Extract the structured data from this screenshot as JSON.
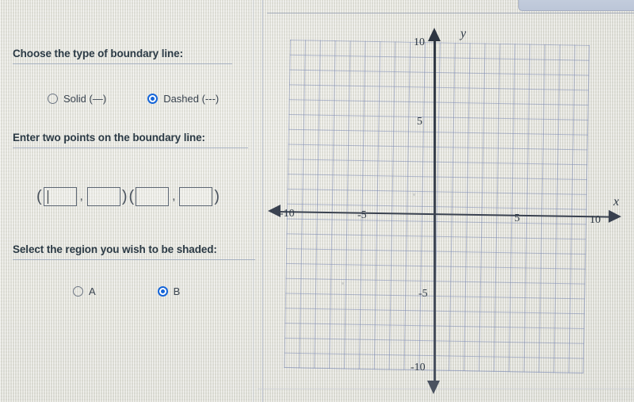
{
  "background": {
    "page_color": "#e9e9e3",
    "grid_color": "#7886b2",
    "axis_color": "#3a4250",
    "accent_color": "#1565d8"
  },
  "left_panel": {
    "question_1": {
      "heading": "Choose the type of boundary line:",
      "options": [
        {
          "label": "Solid (—)",
          "selected": false
        },
        {
          "label": "Dashed (---)",
          "selected": true
        }
      ]
    },
    "question_2": {
      "heading": "Enter two points on the boundary line:",
      "open_paren": "(",
      "close_paren": ")",
      "comma": ",",
      "fields": [
        {
          "value": "",
          "focused": true
        },
        {
          "value": "",
          "focused": false
        },
        {
          "value": "",
          "focused": false
        },
        {
          "value": "",
          "focused": false
        }
      ]
    },
    "question_3": {
      "heading": "Select the region you wish to be shaded:",
      "options": [
        {
          "label": "A",
          "selected": false
        },
        {
          "label": "B",
          "selected": true
        }
      ]
    }
  },
  "chart_data": {
    "type": "scatter",
    "title": "",
    "xlabel": "x",
    "ylabel": "y",
    "xlim": [
      -10,
      10
    ],
    "ylim": [
      -10,
      10
    ],
    "x_ticks": [
      "-10",
      "-5",
      "5",
      "10"
    ],
    "y_ticks": [
      "10",
      "5",
      "-5",
      "-10"
    ],
    "grid": true,
    "grid_step": 1,
    "legend": "none",
    "series": [],
    "annotations": []
  }
}
